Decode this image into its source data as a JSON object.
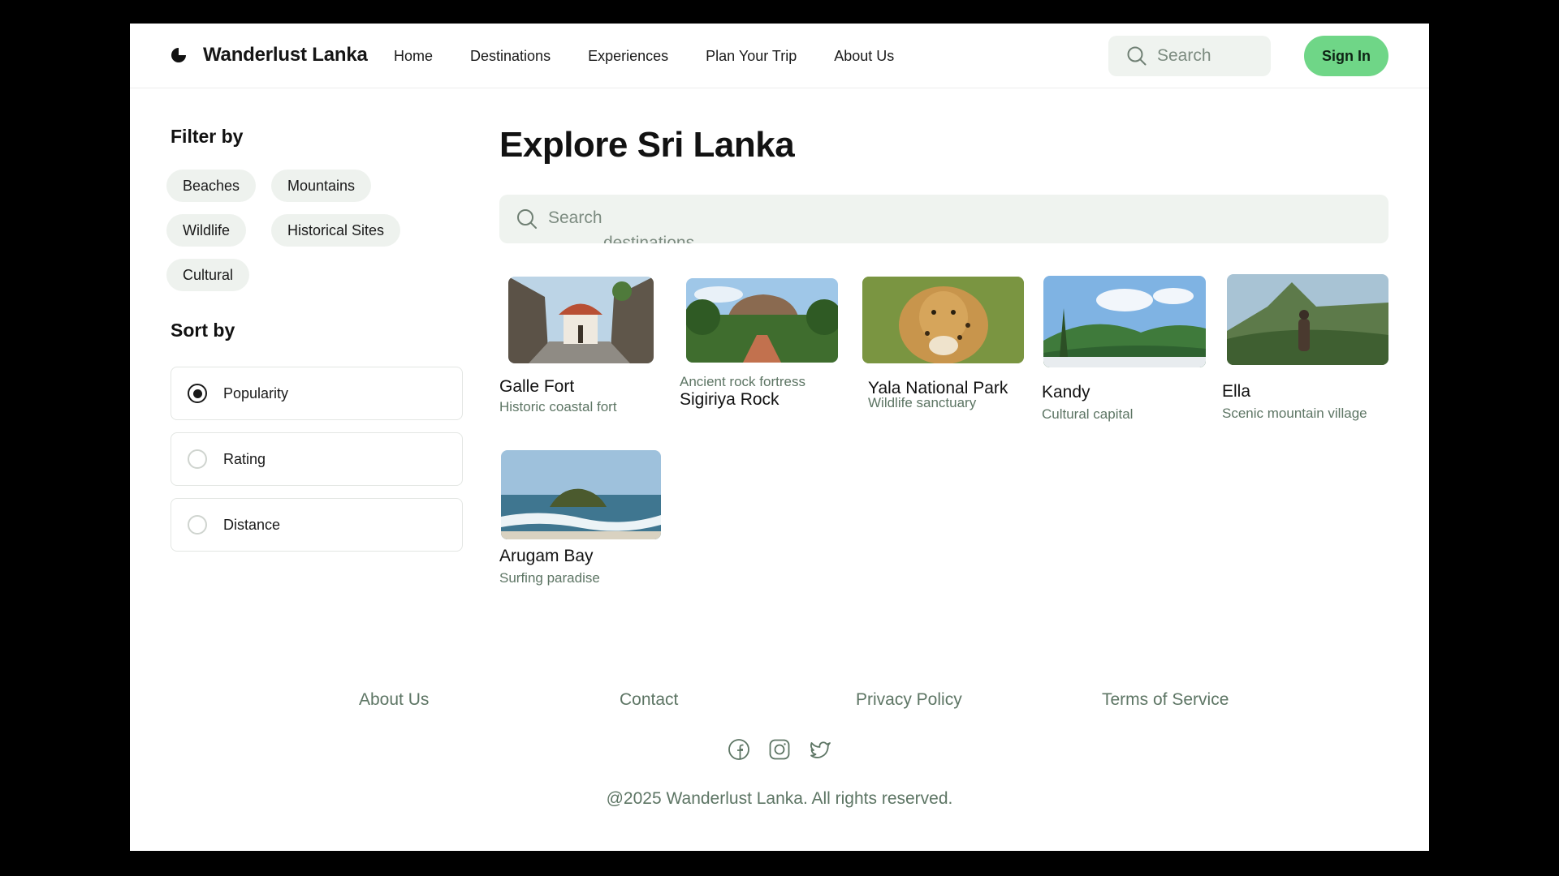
{
  "brand": {
    "name": "Wanderlust Lanka"
  },
  "nav": {
    "home": "Home",
    "destinations": "Destinations",
    "experiences": "Experiences",
    "plan": "Plan Your Trip",
    "about": "About Us"
  },
  "header": {
    "search_placeholder": "Search",
    "sign_in": "Sign In"
  },
  "sidebar": {
    "filter_title": "Filter by",
    "filters": [
      "Beaches",
      "Mountains",
      "Wildlife",
      "Historical Sites",
      "Cultural"
    ],
    "sort_title": "Sort by",
    "sort_options": [
      "Popularity",
      "Rating",
      "Distance"
    ],
    "sort_selected": "Popularity"
  },
  "main": {
    "title": "Explore Sri Lanka",
    "search_placeholder_line1": "Search",
    "search_placeholder_line2": "destinations",
    "destinations": [
      {
        "name": "Galle Fort",
        "desc": "Historic coastal fort"
      },
      {
        "name": "Sigiriya Rock",
        "desc": "Ancient rock fortress"
      },
      {
        "name": "Yala National Park",
        "desc": "Wildlife sanctuary"
      },
      {
        "name": "Kandy",
        "desc": "Cultural capital"
      },
      {
        "name": "Ella",
        "desc": "Scenic mountain village"
      },
      {
        "name": "Arugam Bay",
        "desc": "Surfing paradise"
      }
    ]
  },
  "footer": {
    "links": [
      "About Us",
      "Contact",
      "Privacy Policy",
      "Terms of Service"
    ],
    "social_icons": [
      "facebook-icon",
      "instagram-icon",
      "twitter-icon"
    ],
    "copyright": "@2025 Wanderlust Lanka. All rights reserved."
  },
  "colors": {
    "accent": "#6fd687",
    "muted_text": "#5d7564",
    "input_bg": "#eff3ef",
    "chip_bg": "#eef2ee"
  }
}
